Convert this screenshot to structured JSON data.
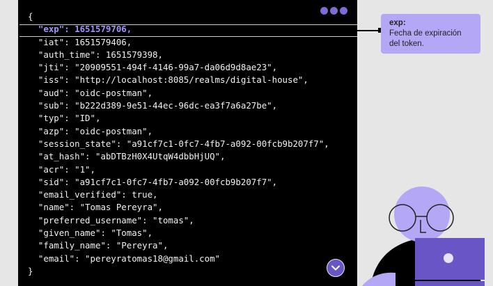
{
  "code": {
    "open_brace": "{",
    "close_brace": "}",
    "highlight_line": "\"exp\": 1651579706,",
    "lines": [
      "\"iat\": 1651579406,",
      "\"auth_time\": 1651579398,",
      "\"jti\": \"20909551-494f-4146-99a7-da06d9d8ae23\",",
      "\"iss\": \"http://localhost:8085/realms/digital-house\",",
      "\"aud\": \"oidc-postman\",",
      "\"sub\": \"b222d389-9e51-44ec-96dc-ea3f7a6a27be\",",
      "\"typ\": \"ID\",",
      "\"azp\": \"oidc-postman\",",
      "\"session_state\": \"a91cf7c1-0fc7-4fb7-a092-00fcb9b207f7\",",
      "\"at_hash\": \"abDTBzH0X4UtqW4dbbHjUQ\",",
      "\"acr\": \"1\",",
      "\"sid\": \"a91cf7c1-0fc7-4fb7-a092-00fcb9b207f7\",",
      "\"email_verified\": true,",
      "\"name\": \"Tomas Pereyra\",",
      "\"preferred_username\": \"tomas\",",
      "\"given_name\": \"Tomas\",",
      "\"family_name\": \"Pereyra\",",
      "\"email\": \"pereyratomas18@gmail.com\""
    ]
  },
  "tooltip": {
    "title": "exp:",
    "text_line1": "Fecha de expiración",
    "text_line2": "del token."
  },
  "colors": {
    "panel_bg": "#000000",
    "accent": "#7d6bd6",
    "tooltip_bg": "#b3a7f6",
    "page_bg": "#e6e6e6"
  },
  "icons": {
    "scroll": "chevron-down-icon",
    "window_dots": "window-dots-icon"
  }
}
